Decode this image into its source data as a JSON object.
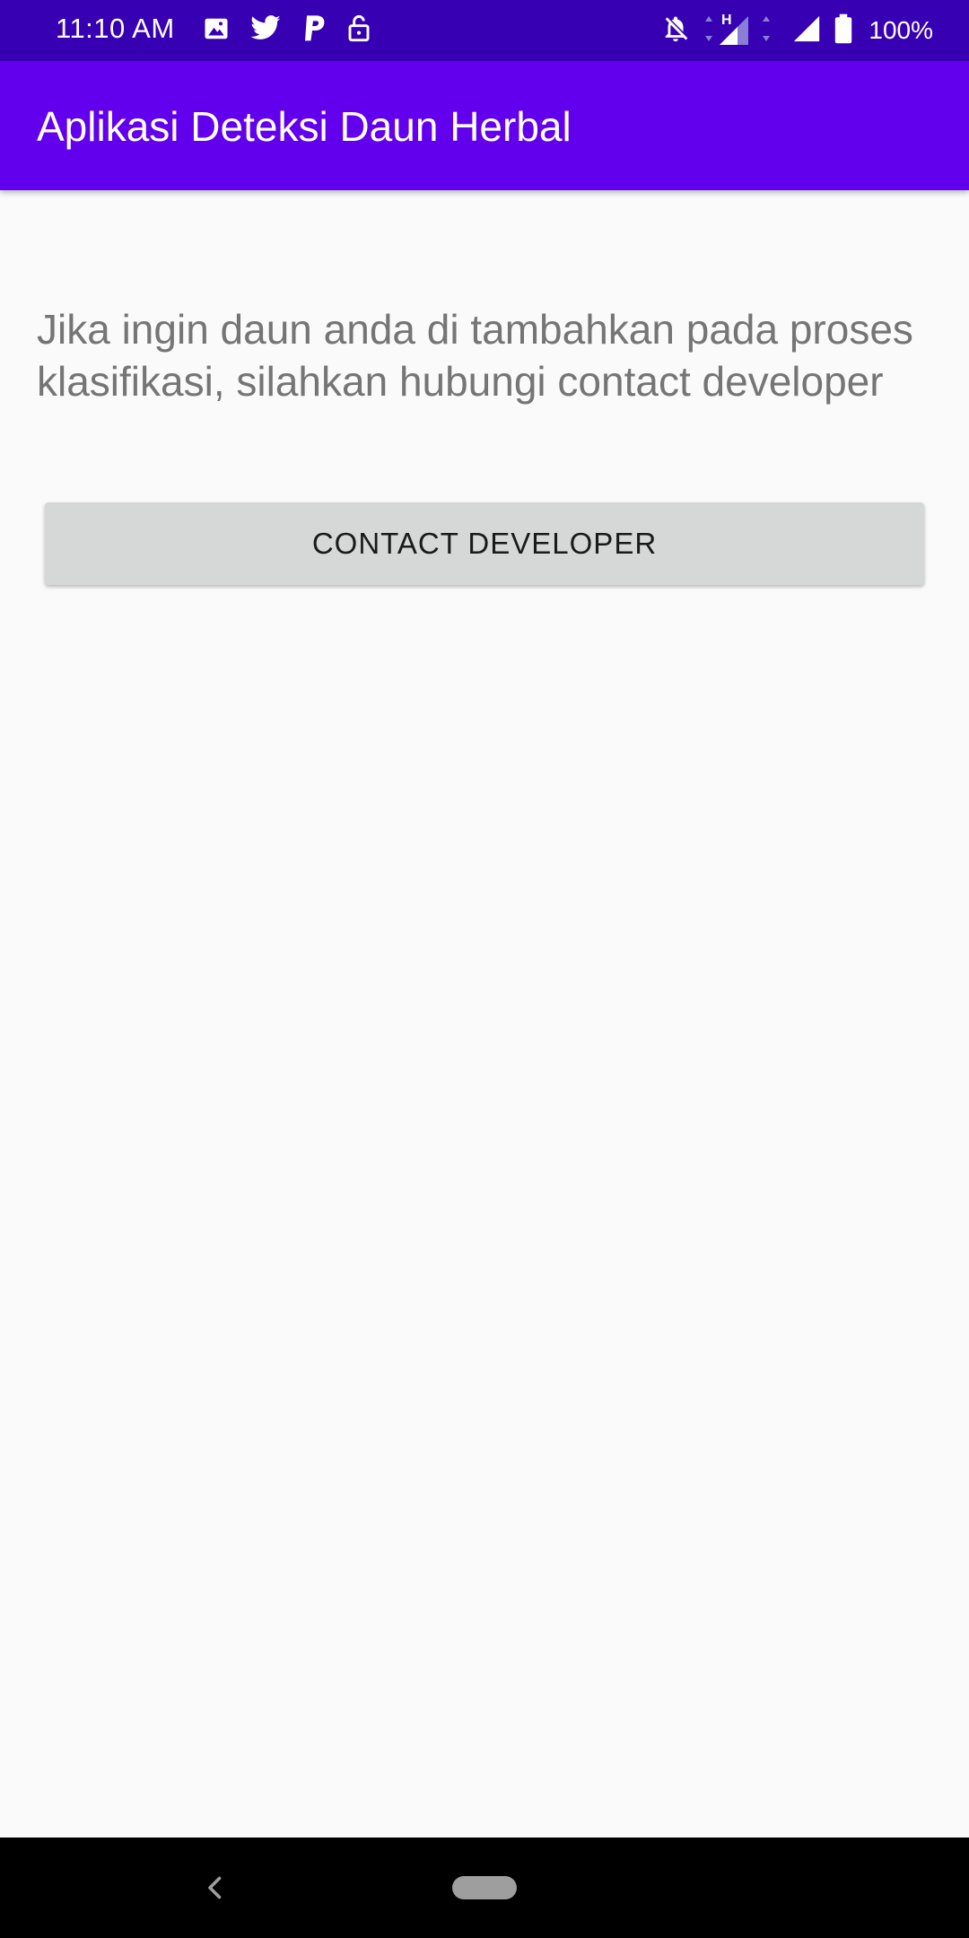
{
  "status_bar": {
    "time": "11:10 AM",
    "battery": "100%",
    "network_type": "H",
    "left_icons": [
      "image-icon",
      "twitter-icon",
      "paypal-icon",
      "unlock-icon"
    ],
    "right_icons": [
      "notifications-off-icon",
      "signal-h-icon",
      "signal-icon",
      "battery-icon"
    ]
  },
  "app_bar": {
    "title": "Aplikasi Deteksi Daun Herbal",
    "background": "#6200ee"
  },
  "main": {
    "info_text": "Jika ingin daun anda di tambahkan pada proses klasifikasi, silahkan hubungi contact developer",
    "contact_button_label": "CONTACT DEVELOPER"
  },
  "colors": {
    "status_bar": "#3700b3",
    "app_bar": "#6200ee",
    "background": "#fafafa",
    "button": "#d6d7d7",
    "info_text": "#757575"
  },
  "nav_bar": {
    "icons": [
      "back-icon",
      "home-pill-icon"
    ]
  }
}
